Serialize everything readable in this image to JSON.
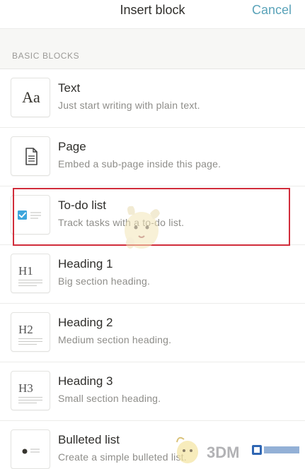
{
  "header": {
    "title": "Insert block",
    "cancel_label": "Cancel",
    "accent_color": "#5aa3b9"
  },
  "section": {
    "label": "BASIC BLOCKS"
  },
  "blocks": [
    {
      "icon": "aa-icon",
      "icon_text": "Aa",
      "title": "Text",
      "subtitle": "Just start writing with plain text."
    },
    {
      "icon": "page-icon",
      "title": "Page",
      "subtitle": "Embed a sub-page inside this page."
    },
    {
      "icon": "todo-checkbox-icon",
      "title": "To-do list",
      "subtitle": "Track tasks with a to-do list.",
      "highlighted": true
    },
    {
      "icon": "heading1-icon",
      "icon_text": "H1",
      "title": "Heading 1",
      "subtitle": "Big section heading."
    },
    {
      "icon": "heading2-icon",
      "icon_text": "H2",
      "title": "Heading 2",
      "subtitle": "Medium section heading."
    },
    {
      "icon": "heading3-icon",
      "icon_text": "H3",
      "title": "Heading 3",
      "subtitle": "Small section heading."
    },
    {
      "icon": "bullet-list-icon",
      "title": "Bulleted list",
      "subtitle": "Create a simple bulleted list."
    }
  ],
  "highlight_color": "#d12d3b",
  "watermark": {
    "text": "3DM"
  }
}
